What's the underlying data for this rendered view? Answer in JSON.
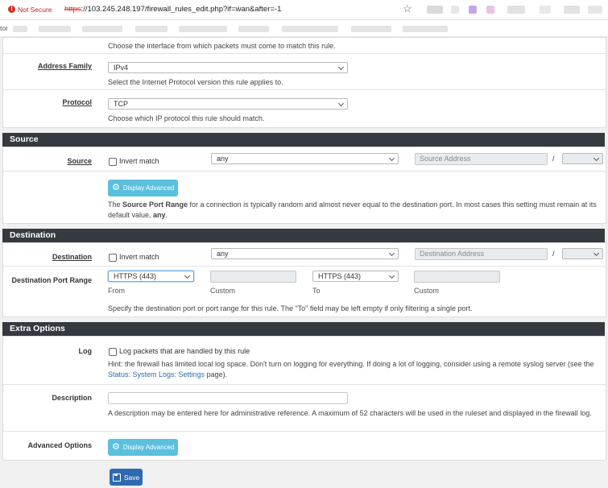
{
  "browser": {
    "security_label": "Not Secure",
    "url_scheme": "https",
    "url_rest": "://103.245.248.197/firewall_rules_edit.php?if=wan&after=-1",
    "bookmark_text": "tor"
  },
  "interface_help": "Choose the interface from which packets must come to match this rule.",
  "address_family": {
    "label": "Address Family",
    "value": "IPv4",
    "help": "Select the Internet Protocol version this rule applies to."
  },
  "protocol": {
    "label": "Protocol",
    "value": "TCP",
    "help": "Choose which IP protocol this rule should match."
  },
  "source": {
    "header": "Source",
    "label": "Source",
    "invert_label": "Invert match",
    "type_value": "any",
    "address_placeholder": "Source Address",
    "slash": "/",
    "display_advanced": "Display Advanced",
    "help_pre": "The ",
    "help_bold": "Source Port Range",
    "help_mid": " for a connection is typically random and almost never equal to the destination port. In most cases this setting must remain at its default value, ",
    "help_any": "any",
    "help_end": "."
  },
  "destination": {
    "header": "Destination",
    "label": "Destination",
    "invert_label": "Invert match",
    "type_value": "any",
    "address_placeholder": "Destination Address",
    "slash": "/",
    "port_range_label": "Destination Port Range",
    "from_value": "HTTPS (443)",
    "to_value": "HTTPS (443)",
    "from_label": "From",
    "custom_label": "Custom",
    "to_label": "To",
    "custom_label2": "Custom",
    "help": "Specify the destination port or port range for this rule. The \"To\" field may be left empty if only filtering a single port."
  },
  "extra": {
    "header": "Extra Options",
    "log_label": "Log",
    "log_checkbox_label": "Log packets that are handled by this rule",
    "log_help": "Hint: the firewall has limited local log space. Don't turn on logging for everything. If doing a lot of logging, consider using a remote syslog server (see the ",
    "log_link": "Status: System Logs: Settings",
    "log_help_end": " page).",
    "description_label": "Description",
    "description_value": "",
    "description_help": "A description may be entered here for administrative reference. A maximum of 52 characters will be used in the ruleset and displayed in the firewall log.",
    "advanced_label": "Advanced Options",
    "display_advanced": "Display Advanced"
  },
  "save_label": "Save",
  "colors": {
    "section_bg": "#343a40",
    "info_btn": "#5bc0de",
    "save_btn": "#2f6ab0"
  }
}
